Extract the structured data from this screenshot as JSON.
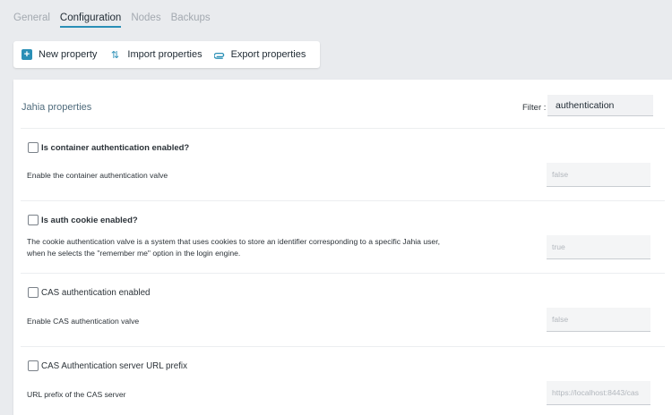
{
  "tabs": [
    {
      "label": "General",
      "active": false
    },
    {
      "label": "Configuration",
      "active": true
    },
    {
      "label": "Nodes",
      "active": false
    },
    {
      "label": "Backups",
      "active": false
    }
  ],
  "toolbar": {
    "new_property": "New property",
    "import_properties": "Import properties",
    "export_properties": "Export properties"
  },
  "panel": {
    "title": "Jahia properties",
    "filter_label": "Filter :",
    "filter_value": "authentication"
  },
  "properties": [
    {
      "label": "Is container authentication enabled?",
      "description": "Enable the container authentication valve",
      "value": "false",
      "checked": false
    },
    {
      "label": "Is auth cookie enabled?",
      "description_line1": "The cookie authentication valve is a system that uses cookies to store an identifier corresponding to a specific Jahia user,",
      "description_line2": "when he selects the \"remember me\" option in the login engine.",
      "value": "true",
      "checked": false
    },
    {
      "label": "CAS authentication enabled",
      "description": "Enable CAS authentication valve",
      "value": "false",
      "checked": false
    },
    {
      "label": "CAS Authentication server URL prefix",
      "description": "URL prefix of the CAS server",
      "value": "https://localhost:8443/cas",
      "checked": false
    }
  ],
  "colors": {
    "accent": "#2a8fb6",
    "background": "#e9ebee"
  }
}
